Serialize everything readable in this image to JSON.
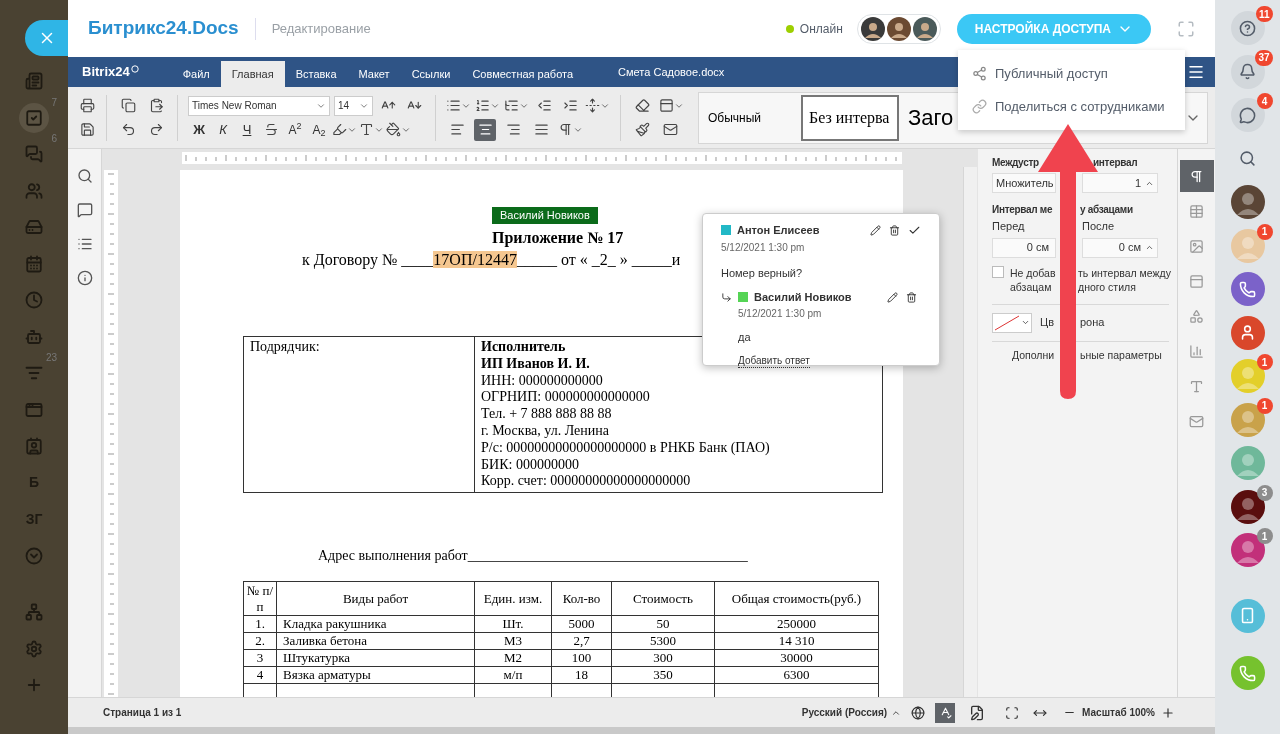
{
  "sidebar_left": {
    "items": [
      {
        "kind": "feed",
        "selected": false
      },
      {
        "kind": "tasks",
        "badge": "7",
        "selected": true
      },
      {
        "kind": "chat",
        "badge": "6",
        "selected": false
      },
      {
        "kind": "group",
        "selected": false
      },
      {
        "kind": "drive",
        "selected": false
      },
      {
        "kind": "calendar",
        "selected": false
      },
      {
        "kind": "time",
        "selected": false
      },
      {
        "kind": "robot",
        "selected": false
      },
      {
        "kind": "filter",
        "badge": "23",
        "selected": false
      },
      {
        "kind": "window",
        "selected": false
      },
      {
        "kind": "contact",
        "selected": false
      },
      {
        "kind": "text",
        "label": "Б",
        "selected": false
      },
      {
        "kind": "text",
        "label": "ЗГ",
        "selected": false
      },
      {
        "kind": "more",
        "selected": false
      },
      {
        "kind": "sitemap",
        "selected": false
      },
      {
        "kind": "settings",
        "selected": false
      },
      {
        "kind": "add",
        "selected": false
      }
    ]
  },
  "header": {
    "logo": "Битрикс24",
    "logo_suffix": ".Docs",
    "mode": "Редактирование",
    "status": "Онлайн",
    "access_button": "НАСТРОЙКА ДОСТУПА"
  },
  "access_menu": [
    {
      "kind": "share",
      "label": "Публичный доступ"
    },
    {
      "kind": "link",
      "label": "Поделиться с сотрудниками"
    }
  ],
  "menubar": {
    "brand": "Bitrix24",
    "tabs": [
      {
        "label": "Файл",
        "selected": false
      },
      {
        "label": "Главная",
        "selected": true
      },
      {
        "label": "Вставка",
        "selected": false
      },
      {
        "label": "Макет",
        "selected": false
      },
      {
        "label": "Ссылки",
        "selected": false
      },
      {
        "label": "Совместная работа",
        "selected": false
      }
    ],
    "file_name": "Смета Садовое.docx"
  },
  "toolbar": {
    "font": "Times New Roman",
    "size": "14",
    "format_buttons": [
      "Ж",
      "К",
      "Ч"
    ],
    "script_buttons": [
      "A$^{2}$",
      "A$_{2}$"
    ],
    "align_buttons": [
      {
        "selected": false
      },
      {
        "selected": true
      },
      {
        "selected": false
      },
      {
        "selected": false
      }
    ],
    "styles": [
      {
        "label": "Обычный",
        "selected": false
      },
      {
        "label": "Без интерва",
        "selected": true
      },
      {
        "label": "Заго",
        "selected": false
      }
    ]
  },
  "document": {
    "author_label": "Василий Новиков",
    "heading": "Приложение № 17",
    "contract_before": "к Договору № ____",
    "contract_highlight": "17ОП/12447",
    "contract_after": "_____ от « _2_ » _____и",
    "parties": {
      "left": "Подрядчик:",
      "right": [
        {
          "text": "Исполнитель",
          "bold": true
        },
        {
          "text": "ИП Иванов И. И.",
          "bold": true
        },
        {
          "text": "ИНН: 000000000000",
          "bold": false
        },
        {
          "text": "ОГРНИП: 000000000000000",
          "bold": false
        },
        {
          "text": "Тел. + 7 888 888 88 88",
          "bold": false
        },
        {
          "text": "г. Москва, ул. Ленина",
          "bold": false
        },
        {
          "text": "Р/с: 00000000000000000000 в РНКБ Банк (ПАО)",
          "bold": false
        },
        {
          "text": "БИК: 000000000",
          "bold": false
        },
        {
          "text": "Корр. счет: 00000000000000000000",
          "bold": false
        }
      ]
    },
    "address": "Адрес выполнения работ________________________________________",
    "works_table": {
      "columns": [
        "№ п/п",
        "Виды работ",
        "Един. изм.",
        "Кол-во",
        "Стоимость",
        "Общая стоимость(руб.)"
      ],
      "rows": [
        [
          "1.",
          "Кладка ракушника",
          "Шт.",
          "5000",
          "50",
          "250000"
        ],
        [
          "2.",
          "Заливка бетона",
          "М3",
          "2,7",
          "5300",
          "14 310"
        ],
        [
          "3",
          "Штукатурка",
          "М2",
          "100",
          "300",
          "30000"
        ],
        [
          "4",
          "Вязка арматуры",
          "м/п",
          "18",
          "350",
          "6300"
        ]
      ]
    }
  },
  "comment": {
    "author": "Антон Елисеев",
    "color": "#22b8c6",
    "date": "5/12/2021 1:30 pm",
    "text": "Номер верный?",
    "replies": [
      {
        "author": "Василий Новиков",
        "color": "#55d455",
        "date": "5/12/2021 1:30 pm",
        "text": "да"
      }
    ],
    "add_reply": "Добавить ответ"
  },
  "panel": {
    "line_spacing_title": [
      "Междустр",
      "интервал"
    ],
    "line_spacing_mode": "Множитель",
    "line_spacing_value": "1",
    "para_spacing_title": [
      "Интервал ме",
      "у абзацами"
    ],
    "before_label": "Перед",
    "after_label": "После",
    "before_value": "0 см",
    "after_value": "0 см",
    "no_space": {
      "checked": false,
      "lines": [
        [
          "Не добав",
          "ть интервал между"
        ],
        [
          "абзацам",
          "дного стиля"
        ]
      ]
    },
    "background": [
      "Цв",
      "рона"
    ],
    "advanced": [
      "Дополни",
      "ьные параметры"
    ]
  },
  "right_tools": [
    {
      "selected": true
    },
    {
      "selected": false
    },
    {
      "selected": false
    },
    {
      "selected": false
    },
    {
      "selected": false
    },
    {
      "selected": false
    },
    {
      "selected": false
    },
    {
      "selected": false
    }
  ],
  "status_bar": {
    "page": "Страница 1 из 1",
    "language": "Русский (Россия)",
    "spellcheck_on": true,
    "zoom": "Масштаб 100%"
  },
  "sidebar_right": [
    {
      "kind": "help",
      "badge": "11",
      "badge_muted": false
    },
    {
      "kind": "bell",
      "badge": "37",
      "badge_muted": false
    },
    {
      "kind": "chat",
      "badge": "4",
      "badge_muted": false
    },
    {
      "kind": "search"
    },
    {
      "kind": "avatar",
      "color": "#5a4536"
    },
    {
      "kind": "avatar",
      "color": "#e8c8a0",
      "badge": "1",
      "badge_muted": false
    },
    {
      "kind": "phone",
      "color": "#7b62c9"
    },
    {
      "kind": "person",
      "color": "#d9472b"
    },
    {
      "kind": "avatar",
      "color": "#e3cf2a",
      "badge": "1",
      "badge_muted": false
    },
    {
      "kind": "avatar",
      "color": "#c9a24a",
      "badge": "1",
      "badge_muted": false
    },
    {
      "kind": "avatar",
      "color": "#6fb89a"
    },
    {
      "kind": "avatar",
      "color": "#5a0e0e",
      "badge": "3",
      "badge_muted": true
    },
    {
      "kind": "avatar",
      "color": "#c2307a",
      "badge": "1",
      "badge_muted": true
    },
    {
      "kind": "cloud-phone",
      "color": "#56bed8"
    },
    {
      "kind": "call",
      "color": "#76c22e"
    }
  ]
}
